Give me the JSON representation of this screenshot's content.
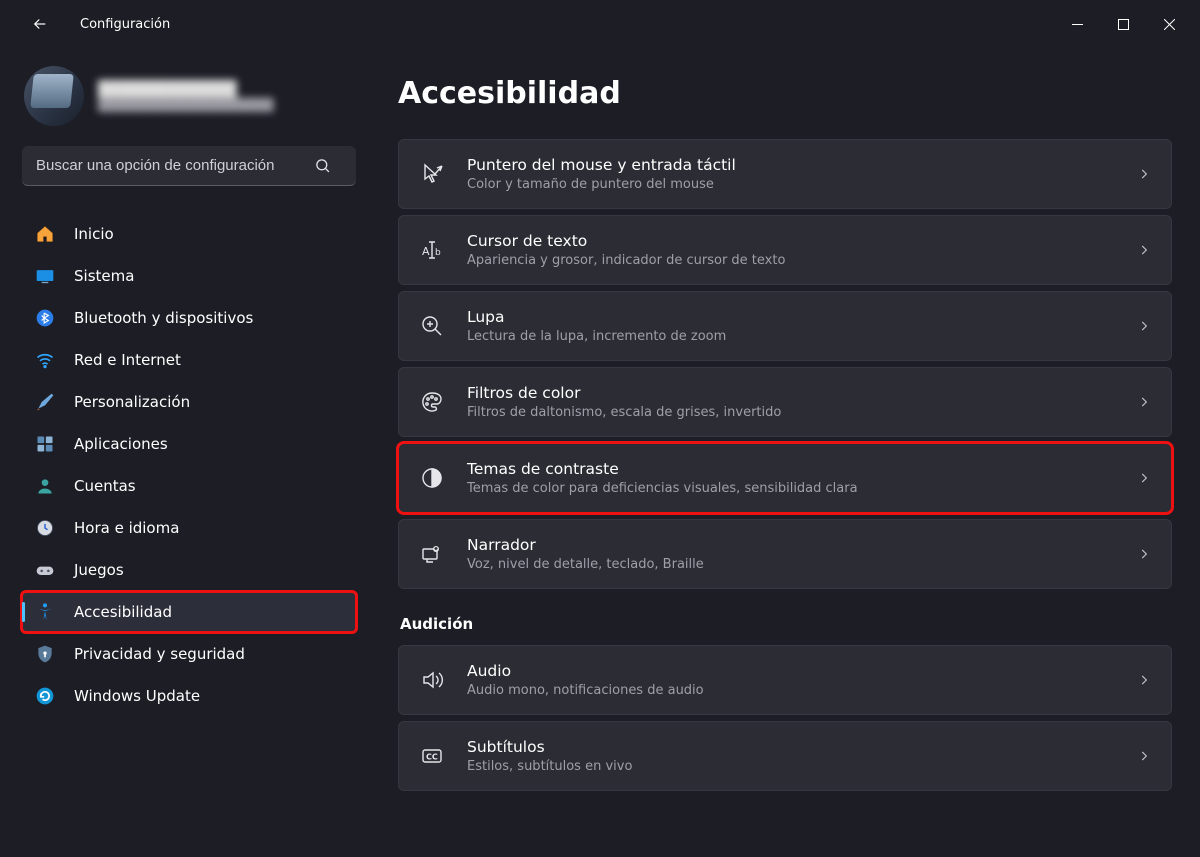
{
  "app": {
    "title": "Configuración"
  },
  "profile": {
    "name": "████████████",
    "email": "███████████████████"
  },
  "search": {
    "placeholder": "Buscar una opción de configuración"
  },
  "sidebar": {
    "items": [
      {
        "id": "inicio",
        "label": "Inicio"
      },
      {
        "id": "sistema",
        "label": "Sistema"
      },
      {
        "id": "bluetooth",
        "label": "Bluetooth y dispositivos"
      },
      {
        "id": "red",
        "label": "Red e Internet"
      },
      {
        "id": "personalizacion",
        "label": "Personalización"
      },
      {
        "id": "aplicaciones",
        "label": "Aplicaciones"
      },
      {
        "id": "cuentas",
        "label": "Cuentas"
      },
      {
        "id": "hora",
        "label": "Hora e idioma"
      },
      {
        "id": "juegos",
        "label": "Juegos"
      },
      {
        "id": "accesibilidad",
        "label": "Accesibilidad"
      },
      {
        "id": "privacidad",
        "label": "Privacidad y seguridad"
      },
      {
        "id": "update",
        "label": "Windows Update"
      }
    ]
  },
  "main": {
    "title": "Accesibilidad",
    "vision": [
      {
        "id": "mouse",
        "title": "Puntero del mouse y entrada táctil",
        "sub": "Color y tamaño de puntero del mouse"
      },
      {
        "id": "cursor",
        "title": "Cursor de texto",
        "sub": "Apariencia y grosor, indicador de cursor de texto"
      },
      {
        "id": "lupa",
        "title": "Lupa",
        "sub": "Lectura de la lupa, incremento de zoom"
      },
      {
        "id": "filtros",
        "title": "Filtros de color",
        "sub": "Filtros de daltonismo, escala de grises, invertido"
      },
      {
        "id": "contraste",
        "title": "Temas de contraste",
        "sub": "Temas de color para deficiencias visuales, sensibilidad clara"
      },
      {
        "id": "narrador",
        "title": "Narrador",
        "sub": "Voz, nivel de detalle, teclado, Braille"
      }
    ],
    "audicion_heading": "Audición",
    "audicion": [
      {
        "id": "audio",
        "title": "Audio",
        "sub": "Audio mono, notificaciones de audio"
      },
      {
        "id": "subtitulos",
        "title": "Subtítulos",
        "sub": "Estilos, subtítulos en vivo"
      }
    ]
  }
}
